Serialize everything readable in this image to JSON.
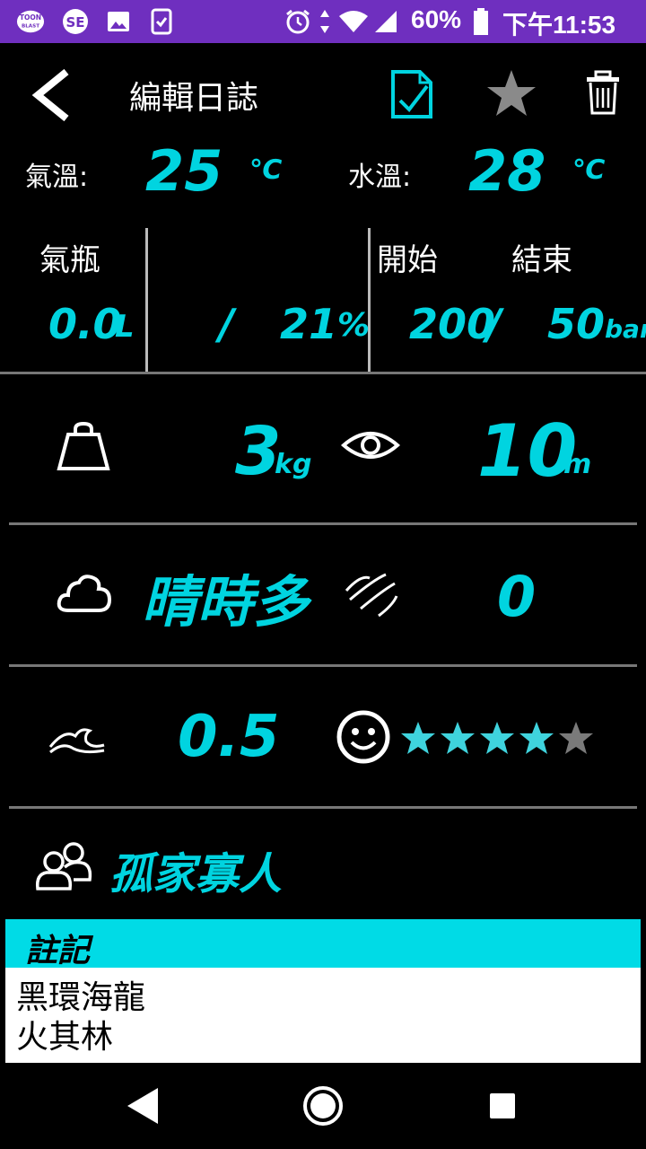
{
  "status_bar": {
    "app_icon_1": "TOON BLAST",
    "app_icon_2": "SE",
    "battery": "60%",
    "time": "下午11:53"
  },
  "header": {
    "title": "編輯日誌"
  },
  "temperature": {
    "air_label": "氣溫:",
    "air_value": "25",
    "air_unit": "℃",
    "water_label": "水溫:",
    "water_value": "28",
    "water_unit": "℃"
  },
  "tank": {
    "label": "氣瓶",
    "volume": "0.0",
    "volume_unit": "L",
    "mix_sep": "/",
    "oxygen": "21",
    "oxygen_unit": "%",
    "start_label": "開始",
    "end_label": "結束",
    "start_pressure": "200",
    "pressure_sep": "/",
    "end_pressure": "50",
    "pressure_unit": "bar"
  },
  "weight": {
    "value": "3",
    "unit": "kg"
  },
  "visibility": {
    "value": "10",
    "unit": "m"
  },
  "weather": {
    "value": "晴時多"
  },
  "wind": {
    "value": "0"
  },
  "waves": {
    "value": "0.5"
  },
  "rating": {
    "value": 4,
    "max": 5
  },
  "buddy": {
    "value": "孤家寡人"
  },
  "notes": {
    "title": "註記",
    "lines": [
      "黑環海龍",
      "火其林"
    ]
  },
  "colors": {
    "accent": "#00d4e0",
    "status_bar": "#6f2fbf",
    "star_on": "#3fd3dd",
    "star_off": "#7a7a7a"
  }
}
